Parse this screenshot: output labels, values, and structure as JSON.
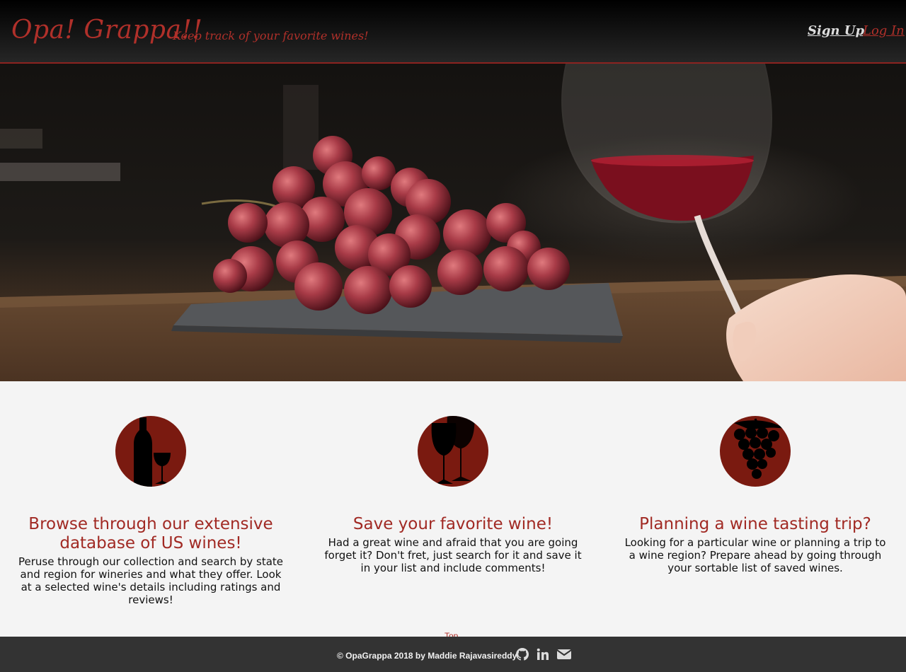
{
  "header": {
    "brand": "Opa! Grappa!!",
    "tagline": "Keep track of your favorite wines!",
    "nav": {
      "signup": "Sign Up",
      "login": "Log In"
    }
  },
  "hero": {
    "image": "grapes-and-red-wine-glass-photo"
  },
  "features": [
    {
      "icon": "wine-bottle-and-glass-icon",
      "title": "Browse through our extensive database of US wines!",
      "text": "Peruse through our collection and search by state and region for wineries and what they offer. Look at a selected wine's details including ratings and reviews!"
    },
    {
      "icon": "wine-glasses-icon",
      "title": "Save your favorite wine!",
      "text": "Had a great wine and afraid that you are going forget it? Don't fret, just search for it and save it in your list and include comments!"
    },
    {
      "icon": "grape-cluster-icon",
      "title": "Planning a wine tasting trip?",
      "text": "Looking for a particular wine or planning a trip to a wine region? Prepare ahead by going through your sortable list of saved wines."
    }
  ],
  "top_link": "Top",
  "footer": {
    "copyright": "© OpaGrappa 2018 by Maddie Rajavasireddy",
    "icons": [
      "github-icon",
      "linkedin-icon",
      "envelope-icon"
    ]
  },
  "colors": {
    "accent": "#a12a24",
    "icon_bg": "#7a1a10",
    "footer_bg": "#333333"
  }
}
